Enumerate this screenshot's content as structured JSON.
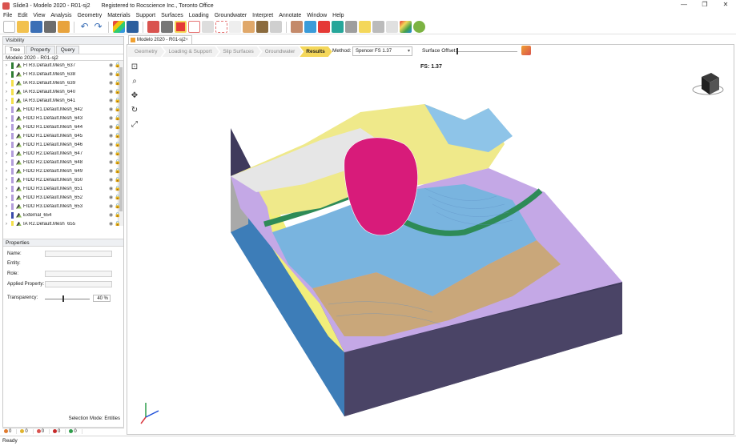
{
  "window": {
    "title": "Slide3 - Modelo 2020 - R01-sj2",
    "registration": "Registered to Rocscience Inc., Toronto Office",
    "controls": [
      "—",
      "❐",
      "✕"
    ]
  },
  "menu": [
    "File",
    "Edit",
    "View",
    "Analysis",
    "Geometry",
    "Materials",
    "Support",
    "Surfaces",
    "Loading",
    "Groundwater",
    "Interpret",
    "Annotate",
    "Window",
    "Help"
  ],
  "left_panel": {
    "visibility_title": "Visibility",
    "tabs": [
      "Tree",
      "Property",
      "Query"
    ],
    "tree_root": "Modelo 2020 - R01-sj2",
    "tree_items": [
      {
        "label": "FI R3.Default.Mesh_637",
        "color": "#2e7d32"
      },
      {
        "label": "FI R3.Default.Mesh_638",
        "color": "#2e7d32"
      },
      {
        "label": "IA R3.Default.Mesh_639",
        "color": "#f4e04a"
      },
      {
        "label": "IA R3.Default.Mesh_640",
        "color": "#f4e04a"
      },
      {
        "label": "IA R3.Default.Mesh_641",
        "color": "#f4e04a"
      },
      {
        "label": "FIDO R1.Default.Mesh_642",
        "color": "#b39ddb"
      },
      {
        "label": "FIDO R1.Default.Mesh_643",
        "color": "#b39ddb"
      },
      {
        "label": "FIDO R1.Default.Mesh_644",
        "color": "#b39ddb"
      },
      {
        "label": "FIDO R1.Default.Mesh_645",
        "color": "#b39ddb"
      },
      {
        "label": "FIDO R1.Default.Mesh_646",
        "color": "#b39ddb"
      },
      {
        "label": "FIDO R2.Default.Mesh_647",
        "color": "#b39ddb"
      },
      {
        "label": "FIDO R2.Default.Mesh_648",
        "color": "#b39ddb"
      },
      {
        "label": "FIDO R2.Default.Mesh_649",
        "color": "#b39ddb"
      },
      {
        "label": "FIDO R2.Default.Mesh_650",
        "color": "#b39ddb"
      },
      {
        "label": "FIDO R3.Default.Mesh_651",
        "color": "#b39ddb"
      },
      {
        "label": "FIDO R3.Default.Mesh_652",
        "color": "#b39ddb"
      },
      {
        "label": "FIDO R3.Default.Mesh_653",
        "color": "#b39ddb"
      },
      {
        "label": "External_654",
        "color": "#3949ab"
      },
      {
        "label": "IA R2.Default.Mesh_655",
        "color": "#f4e04a"
      }
    ],
    "properties_title": "Properties",
    "props": {
      "name": "Name:",
      "entity": "Entity:",
      "role": "Role:",
      "applied_property": "Applied Property:",
      "transparency": "Transparency:"
    },
    "transparency_value": "40 %",
    "transparency_fraction": 0.4,
    "selection_mode": "Selection Mode: Entities"
  },
  "messages": [
    {
      "icon": "info-icon",
      "count": "0",
      "color": "#e07a2e"
    },
    {
      "icon": "warning-icon",
      "count": "0",
      "color": "#e0b42e"
    },
    {
      "icon": "warning-icon",
      "count": "0",
      "color": "#d9534f"
    },
    {
      "icon": "error-icon",
      "count": "0",
      "color": "#c62828"
    },
    {
      "icon": "success-icon",
      "count": "0",
      "color": "#2e9d4a"
    }
  ],
  "doc_tab": {
    "label": "Modelo 2020 - R01-sj2",
    "close": "×"
  },
  "workflow": {
    "steps": [
      "Geometry",
      "Loading & Support",
      "Slip Surfaces",
      "Groundwater",
      "Results"
    ],
    "active": "Results"
  },
  "method": {
    "label": "Method:",
    "value": "Spencer FS   1.37"
  },
  "surface_offset": {
    "label": "Surface Offset:"
  },
  "fs_label": "FS: 1.37",
  "nav_tools": [
    "zoom-window-icon",
    "zoom-icon",
    "pan-icon",
    "rotate-icon",
    "zoom-all-icon"
  ],
  "status": "Ready",
  "colors": {
    "accent": "#f4d75a",
    "slip_surface": "#d81b7a",
    "blue_layer": "#79b4df",
    "yellow_layer": "#efe98a",
    "purple_layer": "#c4a8e6",
    "tan_layer": "#c9a77a",
    "green_band": "#2e8b57",
    "grey_cliff": "#b9b9b9",
    "block_side": "#4a4466"
  }
}
